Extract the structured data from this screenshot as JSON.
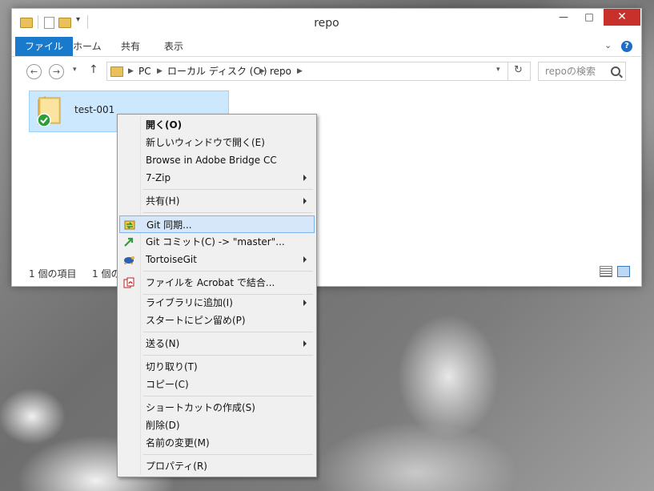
{
  "window": {
    "title": "repo",
    "controls": {
      "minimize": "—",
      "maximize": "□",
      "close": "✕"
    }
  },
  "ribbon": {
    "tabs": [
      "ファイル",
      "ホーム",
      "共有",
      "表示"
    ],
    "expand": "⌄",
    "help": "?"
  },
  "address": {
    "crumbs": [
      "PC",
      "ローカル ディスク (C:)",
      "repo"
    ],
    "search_placeholder": "repoの検索"
  },
  "files": [
    {
      "name": "test-001",
      "icon": "folder-git-icon",
      "selected": true
    }
  ],
  "status": {
    "count": "1 個の項目",
    "selected": "1 個の"
  },
  "context_menu": {
    "items": [
      {
        "label": "開く(O)",
        "bold": true
      },
      {
        "label": "新しいウィンドウで開く(E)"
      },
      {
        "label": "Browse in Adobe Bridge CC"
      },
      {
        "label": "7-Zip",
        "submenu": true
      },
      {
        "label": "共有(H)",
        "submenu": true
      },
      {
        "label": "Git 同期...",
        "icon": "git-sync-icon",
        "highlighted": true
      },
      {
        "label": "Git コミット(C) -> \"master\"...",
        "icon": "git-commit-icon"
      },
      {
        "label": "TortoiseGit",
        "icon": "tortoisegit-icon",
        "submenu": true
      },
      {
        "label": "ファイルを Acrobat で結合...",
        "icon": "acrobat-icon"
      },
      {
        "label": "ライブラリに追加(I)",
        "submenu": true
      },
      {
        "label": "スタートにピン留め(P)"
      },
      {
        "label": "送る(N)",
        "submenu": true
      },
      {
        "label": "切り取り(T)"
      },
      {
        "label": "コピー(C)"
      },
      {
        "label": "ショートカットの作成(S)"
      },
      {
        "label": "削除(D)"
      },
      {
        "label": "名前の変更(M)"
      },
      {
        "label": "プロパティ(R)"
      }
    ]
  },
  "colors": {
    "file_tab": "#1979ca",
    "close_button": "#c7302b",
    "selection": "#cce8ff",
    "menu_highlight": "#d5e7f8"
  }
}
